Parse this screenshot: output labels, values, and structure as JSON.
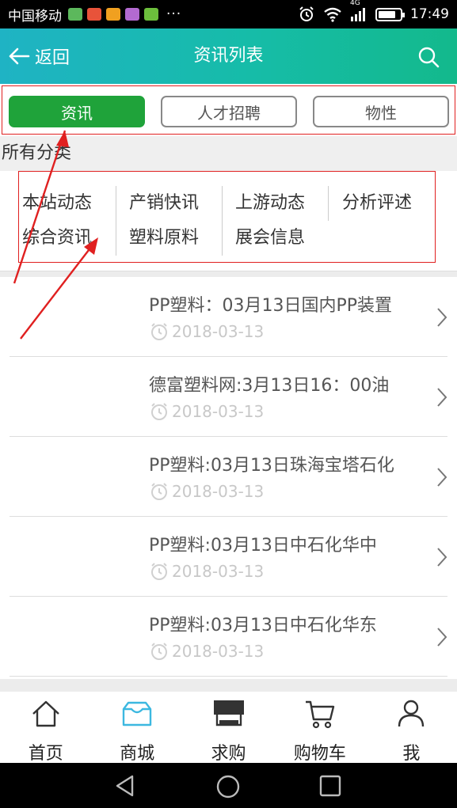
{
  "status_bar": {
    "carrier": "中国移动",
    "dots": "···",
    "network": "4G",
    "time": "17:49",
    "battery_level": 0.8
  },
  "header": {
    "back_label": "返回",
    "title": "资讯列表"
  },
  "tabs": [
    {
      "label": "资讯",
      "active": true
    },
    {
      "label": "人才招聘",
      "active": false
    },
    {
      "label": "物性",
      "active": false
    }
  ],
  "categories": {
    "heading": "所有分类",
    "items": [
      "本站动态",
      "产销快讯",
      "上游动态",
      "分析评述",
      "综合资讯",
      "塑料原料",
      "展会信息"
    ]
  },
  "news": [
    {
      "title": "PP塑料：03月13日国内PP装置",
      "date": "2018-03-13"
    },
    {
      "title": "德富塑料网:3月13日16：00油",
      "date": "2018-03-13"
    },
    {
      "title": "PP塑料:03月13日珠海宝塔石化",
      "date": "2018-03-13"
    },
    {
      "title": "PP塑料:03月13日中石化华中",
      "date": "2018-03-13"
    },
    {
      "title": "PP塑料:03月13日中石化华东",
      "date": "2018-03-13"
    }
  ],
  "bottom_nav": [
    {
      "label": "首页",
      "icon": "home-icon",
      "active": false
    },
    {
      "label": "商城",
      "icon": "inbox-icon",
      "active": true
    },
    {
      "label": "求购",
      "icon": "storefront-icon",
      "active": false
    },
    {
      "label": "购物车",
      "icon": "cart-icon",
      "active": false
    },
    {
      "label": "我",
      "icon": "user-icon",
      "active": false
    }
  ],
  "colors": {
    "header_gradient_start": "#1fb3c4",
    "header_gradient_end": "#13b98c",
    "active_tab": "#1fa33a",
    "annotation_red": "#e02020",
    "active_nav": "#3cb8e0"
  }
}
